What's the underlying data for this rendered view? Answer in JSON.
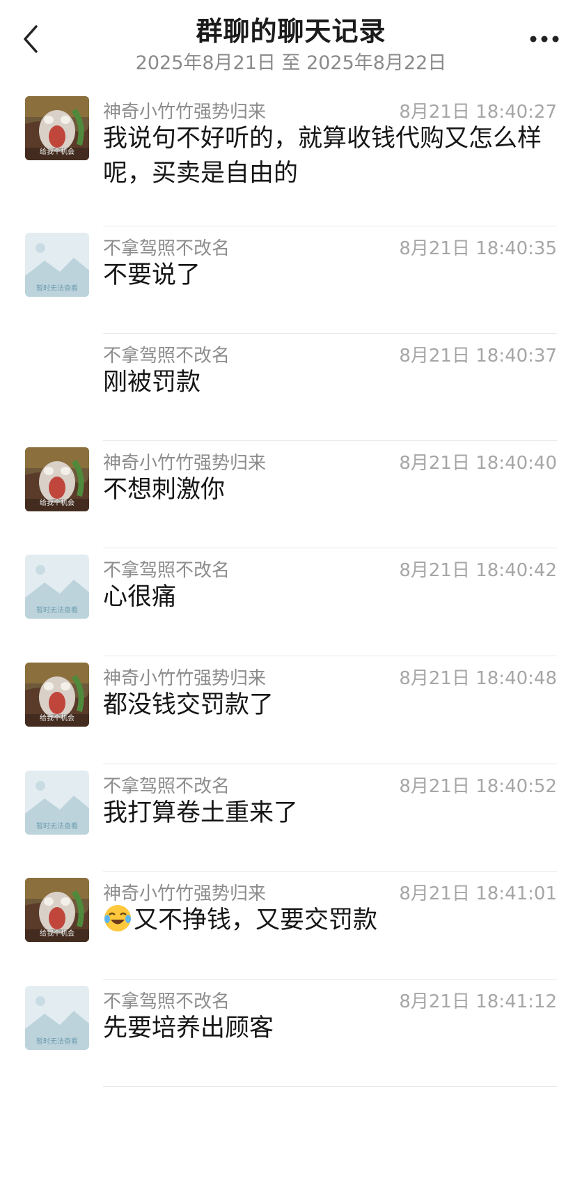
{
  "header": {
    "title": "群聊的聊天记录",
    "subtitle": "2025年8月21日 至 2025年8月22日"
  },
  "avatars": {
    "cartoon_caption": "给我个机会",
    "placeholder_caption": "暂时无法查看"
  },
  "messages": [
    {
      "sender": "神奇小竹竹强势归来",
      "time": "8月21日 18:40:27",
      "text": "我说句不好听的，就算收钱代购又怎么样呢，买卖是自由的",
      "avatar": "cartoon"
    },
    {
      "sender": "不拿驾照不改名",
      "time": "8月21日 18:40:35",
      "text": "不要说了",
      "avatar": "placeholder"
    },
    {
      "sender": "不拿驾照不改名",
      "time": "8月21日 18:40:37",
      "text": "刚被罚款",
      "avatar": "none"
    },
    {
      "sender": "神奇小竹竹强势归来",
      "time": "8月21日 18:40:40",
      "text": "不想刺激你",
      "avatar": "cartoon"
    },
    {
      "sender": "不拿驾照不改名",
      "time": "8月21日 18:40:42",
      "text": "心很痛",
      "avatar": "placeholder"
    },
    {
      "sender": "神奇小竹竹强势归来",
      "time": "8月21日 18:40:48",
      "text": "都没钱交罚款了",
      "avatar": "cartoon"
    },
    {
      "sender": "不拿驾照不改名",
      "time": "8月21日 18:40:52",
      "text": "我打算卷土重来了",
      "avatar": "placeholder"
    },
    {
      "sender": "神奇小竹竹强势归来",
      "time": "8月21日 18:41:01",
      "text": "又不挣钱，又要交罚款",
      "avatar": "cartoon",
      "emoji": "crying-laughing-emoji"
    },
    {
      "sender": "不拿驾照不改名",
      "time": "8月21日 18:41:12",
      "text": "先要培养出顾客",
      "avatar": "placeholder"
    }
  ],
  "colors": {
    "title": "#1b1b1b",
    "meta": "#8c8c8c",
    "time": "#a6a6a6",
    "divider": "#e9e9e9"
  }
}
